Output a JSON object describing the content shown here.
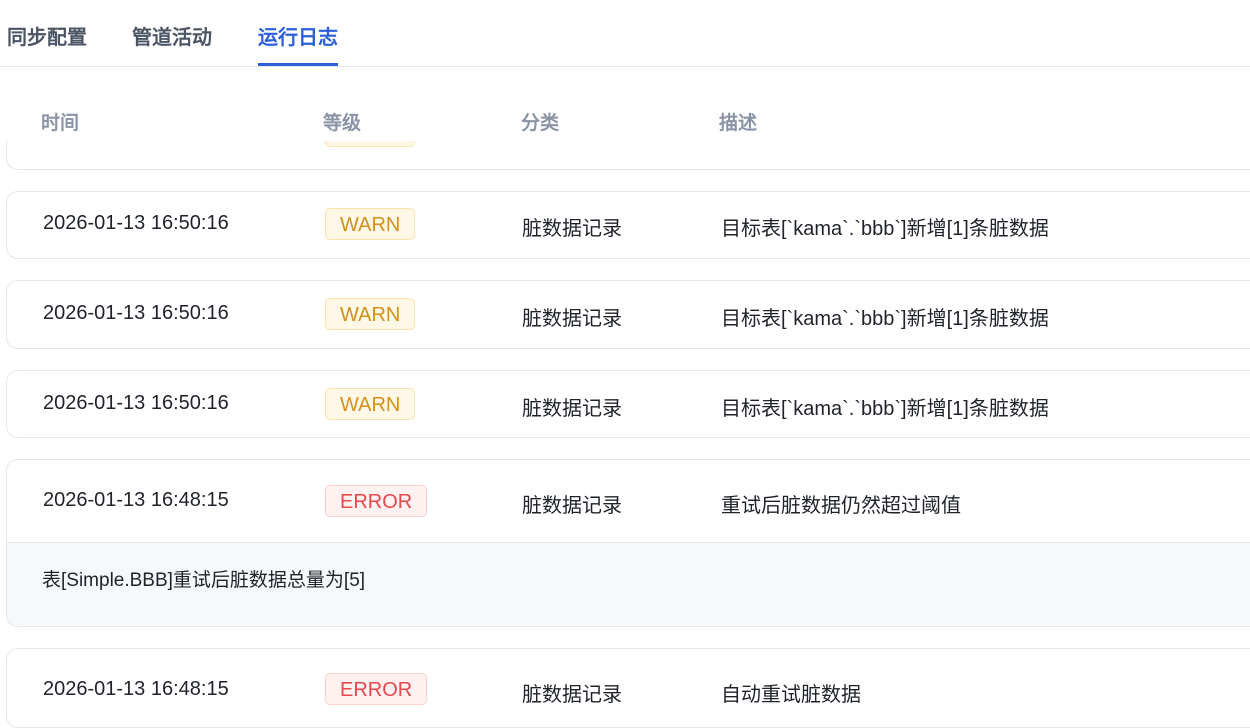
{
  "tabs": [
    {
      "label": "同步配置",
      "active": false
    },
    {
      "label": "管道活动",
      "active": false
    },
    {
      "label": "运行日志",
      "active": true
    }
  ],
  "columns": {
    "time": "时间",
    "level": "等级",
    "category": "分类",
    "description": "描述"
  },
  "logs": [
    {
      "time": "2026-01-13 16:50:16",
      "level": "WARN",
      "category": "脏数据记录",
      "description": "目标表[`kama`.`bbb`]新增[1]条脏数据"
    },
    {
      "time": "2026-01-13 16:50:16",
      "level": "WARN",
      "category": "脏数据记录",
      "description": "目标表[`kama`.`bbb`]新增[1]条脏数据"
    },
    {
      "time": "2026-01-13 16:50:16",
      "level": "WARN",
      "category": "脏数据记录",
      "description": "目标表[`kama`.`bbb`]新增[1]条脏数据"
    },
    {
      "time": "2026-01-13 16:48:15",
      "level": "ERROR",
      "category": "脏数据记录",
      "description": "重试后脏数据仍然超过阈值",
      "detail": "表[Simple.BBB]重试后脏数据总量为[5]"
    },
    {
      "time": "2026-01-13 16:48:15",
      "level": "ERROR",
      "category": "脏数据记录",
      "description": "自动重试脏数据"
    }
  ],
  "colors": {
    "accent": "#2b5fd9",
    "warn": "#d4901c",
    "error": "#e5484d"
  }
}
